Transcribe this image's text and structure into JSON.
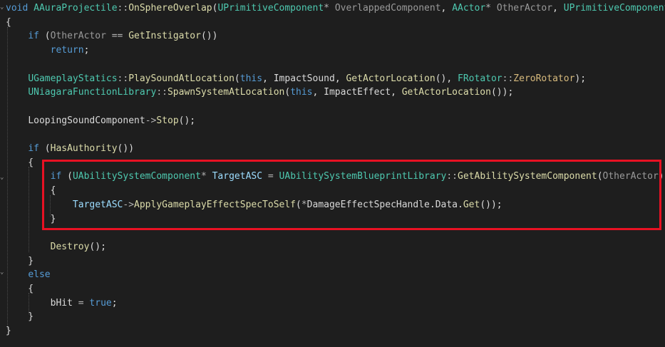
{
  "editor": {
    "language": "C++",
    "theme": {
      "background": "#1e1e1e",
      "keyword": "#569cd6",
      "type": "#4ec9b0",
      "function": "#dcdcaa",
      "parameter": "#9a9a9a",
      "plain": "#dcdcdc",
      "local": "#9cdcfe",
      "highlight_border": "#e81123"
    },
    "lines": [
      [
        [
          "kw",
          "void "
        ],
        [
          "ty",
          "AAuraProjectile"
        ],
        [
          "op",
          "::"
        ],
        [
          "fn",
          "OnSphereOverlap"
        ],
        [
          "pl",
          "("
        ],
        [
          "ty",
          "UPrimitiveComponent"
        ],
        [
          "op",
          "* "
        ],
        [
          "pm",
          "OverlappedComponent"
        ],
        [
          "pl",
          ", "
        ],
        [
          "ty",
          "AActor"
        ],
        [
          "op",
          "* "
        ],
        [
          "pm",
          "OtherActor"
        ],
        [
          "pl",
          ", "
        ],
        [
          "ty",
          "UPrimitiveComponent"
        ],
        [
          "op",
          "*"
        ]
      ],
      [
        [
          "pl",
          "{"
        ]
      ],
      [
        [
          "pl",
          "    "
        ],
        [
          "kw",
          "if "
        ],
        [
          "pl",
          "("
        ],
        [
          "pm",
          "OtherActor"
        ],
        [
          "op",
          " == "
        ],
        [
          "fn",
          "GetInstigator"
        ],
        [
          "pl",
          "())"
        ]
      ],
      [
        [
          "pl",
          "        "
        ],
        [
          "kw",
          "return"
        ],
        [
          "pl",
          ";"
        ]
      ],
      [],
      [
        [
          "pl",
          "    "
        ],
        [
          "ty",
          "UGameplayStatics"
        ],
        [
          "op",
          "::"
        ],
        [
          "fn",
          "PlaySoundAtLocation"
        ],
        [
          "pl",
          "("
        ],
        [
          "kw",
          "this"
        ],
        [
          "pl",
          ", "
        ],
        [
          "mb",
          "ImpactSound"
        ],
        [
          "pl",
          ", "
        ],
        [
          "fn",
          "GetActorLocation"
        ],
        [
          "pl",
          "(), "
        ],
        [
          "ty",
          "FRotator"
        ],
        [
          "op",
          "::"
        ],
        [
          "ct",
          "ZeroRotator"
        ],
        [
          "pl",
          ");"
        ]
      ],
      [
        [
          "pl",
          "    "
        ],
        [
          "ty",
          "UNiagaraFunctionLibrary"
        ],
        [
          "op",
          "::"
        ],
        [
          "fn",
          "SpawnSystemAtLocation"
        ],
        [
          "pl",
          "("
        ],
        [
          "kw",
          "this"
        ],
        [
          "pl",
          ", "
        ],
        [
          "mb",
          "ImpactEffect"
        ],
        [
          "pl",
          ", "
        ],
        [
          "fn",
          "GetActorLocation"
        ],
        [
          "pl",
          "());"
        ]
      ],
      [],
      [
        [
          "pl",
          "    "
        ],
        [
          "mb",
          "LoopingSoundComponent"
        ],
        [
          "op",
          "->"
        ],
        [
          "fn",
          "Stop"
        ],
        [
          "pl",
          "();"
        ]
      ],
      [],
      [
        [
          "pl",
          "    "
        ],
        [
          "kw",
          "if "
        ],
        [
          "pl",
          "("
        ],
        [
          "fn",
          "HasAuthority"
        ],
        [
          "pl",
          "())"
        ]
      ],
      [
        [
          "pl",
          "    {"
        ]
      ],
      [
        [
          "pl",
          "        "
        ],
        [
          "kw",
          "if "
        ],
        [
          "pl",
          "("
        ],
        [
          "ty",
          "UAbilitySystemComponent"
        ],
        [
          "op",
          "* "
        ],
        [
          "lv",
          "TargetASC"
        ],
        [
          "op",
          " = "
        ],
        [
          "ty",
          "UAbilitySystemBlueprintLibrary"
        ],
        [
          "op",
          "::"
        ],
        [
          "fn",
          "GetAbilitySystemComponent"
        ],
        [
          "pl",
          "("
        ],
        [
          "pm",
          "OtherActor"
        ],
        [
          "pl",
          "))"
        ]
      ],
      [
        [
          "pl",
          "        {"
        ]
      ],
      [
        [
          "pl",
          "            "
        ],
        [
          "lv",
          "TargetASC"
        ],
        [
          "op",
          "->"
        ],
        [
          "fn",
          "ApplyGameplayEffectSpecToSelf"
        ],
        [
          "pl",
          "("
        ],
        [
          "op",
          "*"
        ],
        [
          "mb",
          "DamageEffectSpecHandle"
        ],
        [
          "pl",
          "."
        ],
        [
          "mb",
          "Data"
        ],
        [
          "pl",
          "."
        ],
        [
          "fn",
          "Get"
        ],
        [
          "pl",
          "());"
        ]
      ],
      [
        [
          "pl",
          "        }"
        ]
      ],
      [],
      [
        [
          "pl",
          "        "
        ],
        [
          "fn",
          "Destroy"
        ],
        [
          "pl",
          "();"
        ]
      ],
      [
        [
          "pl",
          "    }"
        ]
      ],
      [
        [
          "pl",
          "    "
        ],
        [
          "kw",
          "else"
        ]
      ],
      [
        [
          "pl",
          "    {"
        ]
      ],
      [
        [
          "pl",
          "        "
        ],
        [
          "mb",
          "bHit"
        ],
        [
          "op",
          " = "
        ],
        [
          "kw",
          "true"
        ],
        [
          "pl",
          ";"
        ]
      ],
      [
        [
          "pl",
          "    }"
        ]
      ],
      [
        [
          "pl",
          "}"
        ]
      ]
    ],
    "highlight": {
      "label": "highlighted-region"
    }
  }
}
